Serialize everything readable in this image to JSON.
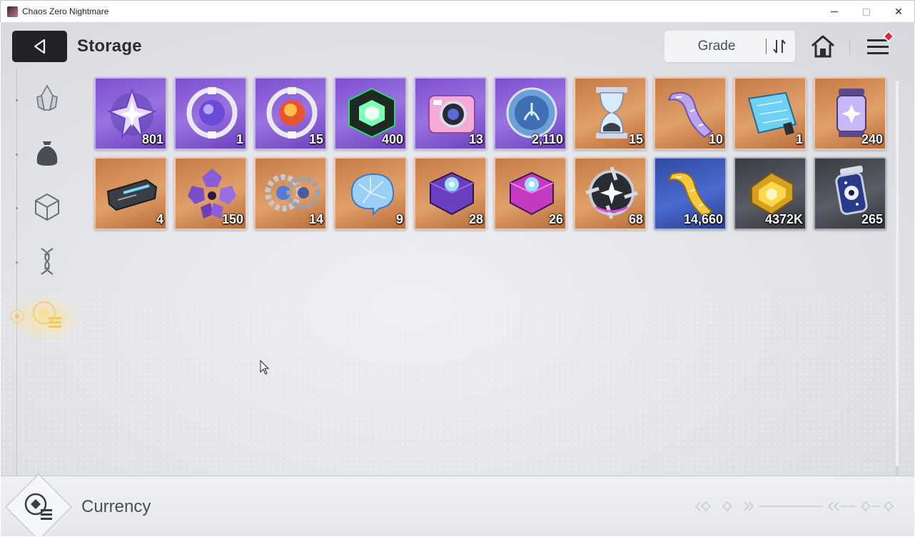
{
  "window": {
    "title": "Chaos Zero Nightmare",
    "minimize_icon": "minimize-icon",
    "maximize_icon": "maximize-icon",
    "close_label": "✕"
  },
  "header": {
    "back_icon": "back-arrow-icon",
    "title": "Storage",
    "sort": {
      "label": "Grade",
      "icon": "sort-order-icon"
    },
    "home_icon": "home-icon",
    "menu_icon": "hamburger-menu-icon",
    "menu_has_notification": true
  },
  "sidebar": {
    "tabs": [
      {
        "icon": "crystal-shards-icon",
        "active": false
      },
      {
        "icon": "pouch-icon",
        "active": false
      },
      {
        "icon": "cube-icon",
        "active": false
      },
      {
        "icon": "dna-helix-icon",
        "active": false
      },
      {
        "icon": "currency-icon",
        "active": true
      }
    ]
  },
  "items": [
    {
      "name": "Purple star crystal",
      "qty": "801",
      "rarity": "purple"
    },
    {
      "name": "Silver orb (purple core)",
      "qty": "1",
      "rarity": "purple"
    },
    {
      "name": "Silver orb (fire core)",
      "qty": "15",
      "rarity": "purple"
    },
    {
      "name": "Green glowing cube",
      "qty": "400",
      "rarity": "purple"
    },
    {
      "name": "Pink camera",
      "qty": "13",
      "rarity": "purple"
    },
    {
      "name": "Blue medal coin",
      "qty": "2,110",
      "rarity": "purple"
    },
    {
      "name": "Hourglass",
      "qty": "15",
      "rarity": "orange"
    },
    {
      "name": "Purple film ribbon",
      "qty": "10",
      "rarity": "orange"
    },
    {
      "name": "Blueprint panel",
      "qty": "1",
      "rarity": "orange"
    },
    {
      "name": "Lantern canister",
      "qty": "240",
      "rarity": "orange"
    },
    {
      "name": "Tech card chip",
      "qty": "4",
      "rarity": "orange"
    },
    {
      "name": "Purple shard cluster",
      "qty": "150",
      "rarity": "orange"
    },
    {
      "name": "Twin gears",
      "qty": "14",
      "rarity": "orange"
    },
    {
      "name": "Blue holo brain",
      "qty": "9",
      "rarity": "orange"
    },
    {
      "name": "Purple gem box",
      "qty": "28",
      "rarity": "orange"
    },
    {
      "name": "Magenta gem box",
      "qty": "26",
      "rarity": "orange"
    },
    {
      "name": "Spiked star emblem",
      "qty": "68",
      "rarity": "orange"
    },
    {
      "name": "Gold film ribbon",
      "qty": "14,660",
      "rarity": "blue"
    },
    {
      "name": "Gold ingot",
      "qty": "4372K",
      "rarity": "gray"
    },
    {
      "name": "Galaxy canister",
      "qty": "265",
      "rarity": "gray"
    }
  ],
  "footer": {
    "emblem_icon": "currency-emblem-icon",
    "label": "Currency"
  },
  "colors": {
    "purple": "#8a5ed8",
    "orange": "#d48d55",
    "blue": "#3a58b8",
    "gray": "#474952",
    "active_tab": "#f5c66a",
    "notification": "#e0243a"
  }
}
